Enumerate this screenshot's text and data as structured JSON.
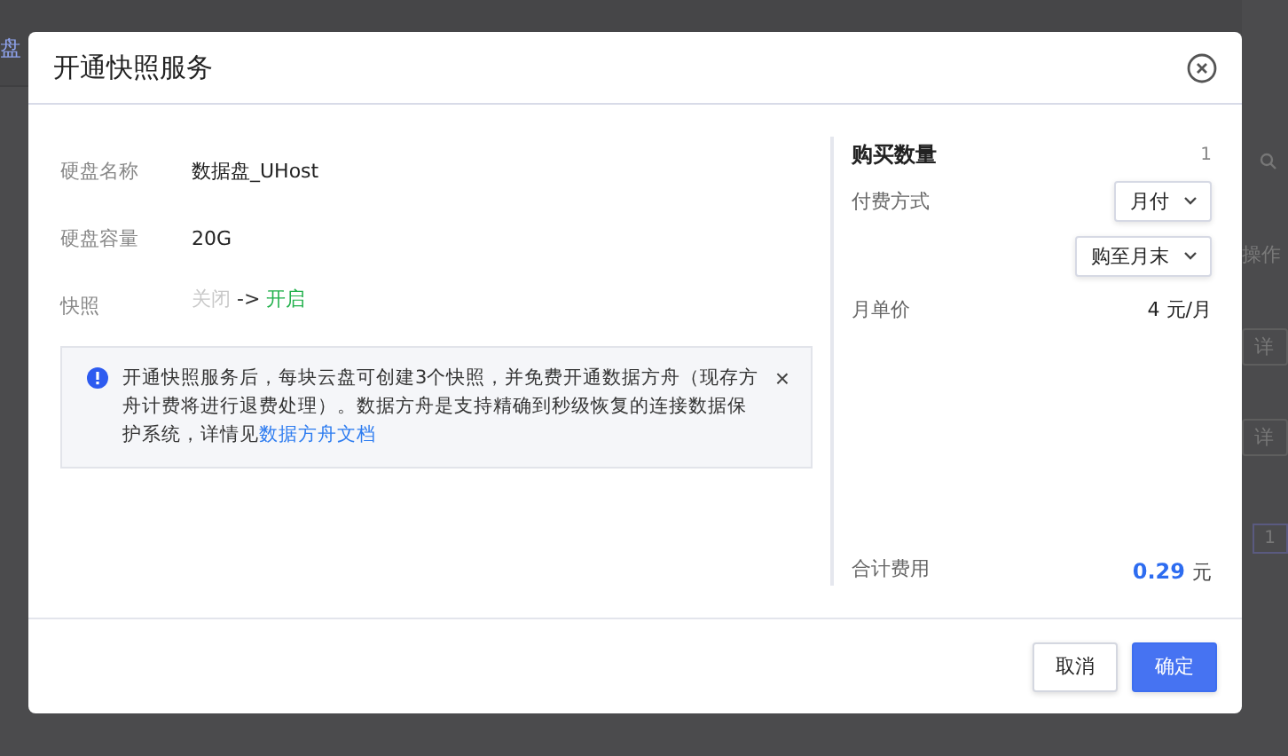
{
  "background_page": {
    "nav_fragment": "盘",
    "column_header": "操作",
    "row_actions": [
      "详",
      "详"
    ],
    "pager": "1"
  },
  "dialog": {
    "title": "开通快照服务",
    "fields": [
      {
        "label": "硬盘名称",
        "value": "数据盘_UHost"
      },
      {
        "label": "硬盘容量",
        "value": "20G"
      }
    ],
    "snapshot": {
      "label": "快照",
      "from": "关闭",
      "arrow": "->",
      "to": "开启"
    },
    "notice": {
      "text": "开通快照服务后，每块云盘可创建3个快照，并免费开通数据方舟（现存方舟计费将进行退费处理）。数据方舟是支持精确到秒级恢复的连接数据保护系统，详情见",
      "link": "数据方舟文档",
      "close": "×"
    },
    "order": {
      "title": "购买数量",
      "quantity": "1",
      "payment_label": "付费方式",
      "payment_select": "月付",
      "duration_select": "购至月末",
      "price_label": "月单价",
      "price": "4 元/月",
      "total_label": "合计费用",
      "total": "0.29",
      "total_unit": "元"
    },
    "buttons": [
      {
        "label": "取消",
        "kind": "secondary"
      },
      {
        "label": "确定",
        "kind": "primary"
      }
    ]
  }
}
